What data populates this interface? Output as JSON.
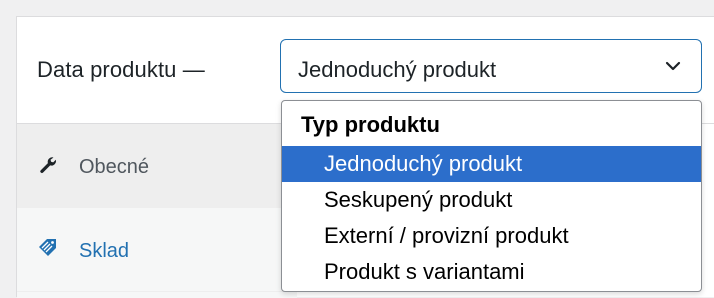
{
  "header": {
    "label": "Data produktu —"
  },
  "product_type_select": {
    "value": "Jednoduchý produkt",
    "open": true
  },
  "tabs": [
    {
      "label": "Obecné",
      "icon": "wrench-icon"
    },
    {
      "label": "Sklad",
      "icon": "tag-icon"
    }
  ],
  "dropdown": {
    "group_label": "Typ produktu",
    "options": [
      {
        "label": "Jednoduchý produkt",
        "selected": true
      },
      {
        "label": "Seskupený produkt",
        "selected": false
      },
      {
        "label": "Externí / provizní produkt",
        "selected": false
      },
      {
        "label": "Produkt s variantami",
        "selected": false
      }
    ]
  },
  "colors": {
    "accent": "#2271b1",
    "selected_option": "#2c6ecb"
  }
}
